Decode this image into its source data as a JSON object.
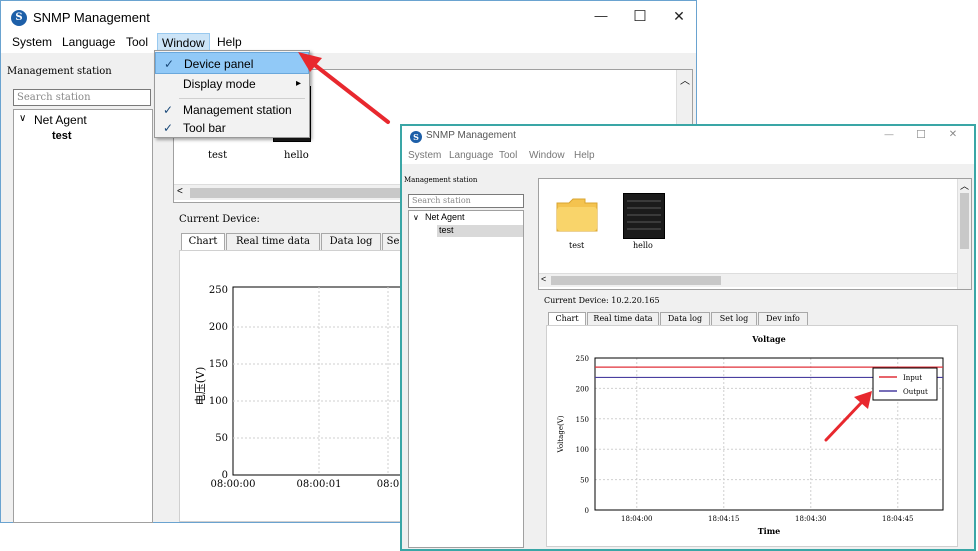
{
  "main_window": {
    "title": "SNMP Management",
    "icon_letter": "S",
    "controls": {
      "minimize": "—",
      "maximize": "☐",
      "close": "✕"
    },
    "menu": [
      "System",
      "Language",
      "Tool",
      "Window",
      "Help"
    ],
    "sidebar_title": "Management station",
    "search_placeholder": "Search station",
    "tree_root": "Net Agent",
    "tree_child": "test",
    "devices": [
      "test",
      "hello"
    ],
    "current_device_label": "Current Device:",
    "tabs": [
      "Chart",
      "Real time data",
      "Data log",
      "Se"
    ],
    "chart": {
      "ylabel": "电压(V)",
      "yticks": [
        "250",
        "200",
        "150",
        "100",
        "50",
        "0"
      ],
      "xticks": [
        "08:00:00",
        "08:00:01",
        "08:0"
      ]
    }
  },
  "window_menu": {
    "items": [
      {
        "label": "Device panel",
        "checked": true,
        "highlighted": true,
        "arrow": false
      },
      {
        "label": "Display mode",
        "checked": false,
        "highlighted": false,
        "arrow": true
      },
      {
        "label": "Management station",
        "checked": true,
        "highlighted": false,
        "arrow": false
      },
      {
        "label": "Tool bar",
        "checked": true,
        "highlighted": false,
        "arrow": false
      }
    ],
    "check_glyph": "✓",
    "submenu_glyph": "▸"
  },
  "second_window": {
    "title": "SNMP Management",
    "icon_letter": "S",
    "controls": {
      "minimize": "—",
      "maximize": "☐",
      "close": "✕"
    },
    "menu": [
      "System",
      "Language",
      "Tool",
      "Window",
      "Help"
    ],
    "sidebar_title": "Management station",
    "search_placeholder": "Search station",
    "tree_root": "Net Agent",
    "tree_child": "test",
    "devices": [
      "test",
      "hello"
    ],
    "current_device_label": "Current Device: 10.2.20.165",
    "tabs": [
      "Chart",
      "Real time data",
      "Data log",
      "Set log",
      "Dev info"
    ]
  },
  "chart_data": {
    "type": "line",
    "title": "Voltage",
    "xlabel": "Time",
    "ylabel": "Voltage(V)",
    "ylim": [
      0,
      250
    ],
    "yticks": [
      0,
      50,
      100,
      150,
      200,
      250
    ],
    "xticks": [
      "18:04:00",
      "18:04:15",
      "18:04:30",
      "18:04:45"
    ],
    "series": [
      {
        "name": "Input",
        "color": "#e0303a",
        "values": [
          235,
          235
        ]
      },
      {
        "name": "Output",
        "color": "#4a3fa0",
        "values": [
          218,
          218
        ]
      }
    ],
    "legend": "top-right",
    "grid": true
  },
  "colors": {
    "arrow": "#e8282e",
    "window_border": "#6aa3d0",
    "highlight": "#91c9f7"
  }
}
